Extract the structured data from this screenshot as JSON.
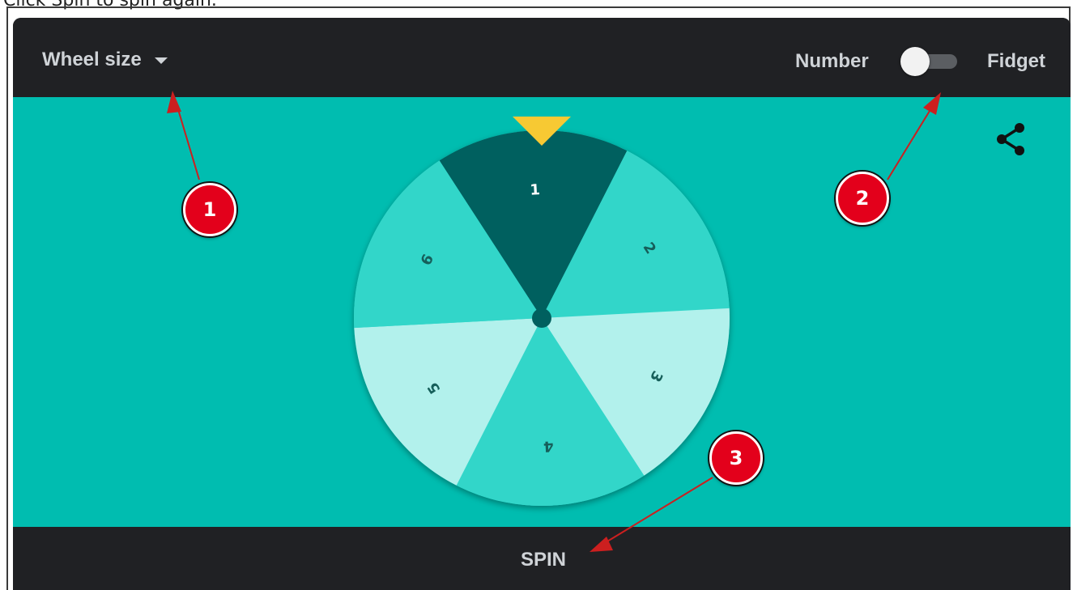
{
  "instruction_text": "Click Spin to spin again.",
  "header": {
    "wheel_size_label": "Wheel size",
    "mode_left_label": "Number",
    "mode_right_label": "Fidget",
    "toggle_on": false
  },
  "wheel": {
    "segments": [
      "1",
      "2",
      "3",
      "4",
      "5",
      "6"
    ],
    "selected": "1",
    "pointer": "pointer-triangle"
  },
  "footer": {
    "spin_label": "SPIN"
  },
  "callouts": [
    "1",
    "2",
    "3"
  ],
  "icons": {
    "share": "share-icon",
    "caret": "chevron-down-icon"
  },
  "colors": {
    "stage_bg": "#00bdb0",
    "bar_bg": "#202124",
    "segment_selected": "#00605f",
    "segment_mid": "#33d6c9",
    "segment_light": "#b2f1ec",
    "pointer": "#f7c933",
    "callout": "#e3001b",
    "arrow": "#cc1f1f"
  }
}
